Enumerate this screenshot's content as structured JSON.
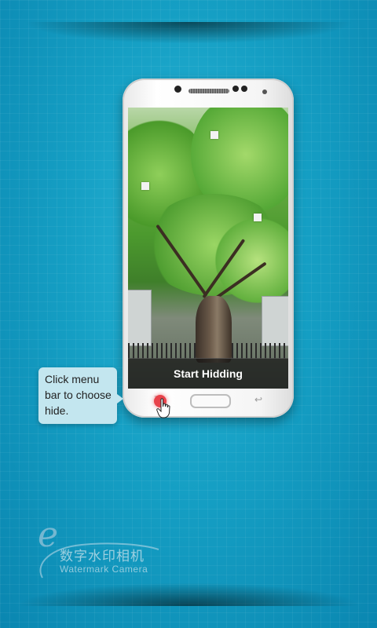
{
  "phone": {
    "screen": {
      "menu_bar_label": "Start Hidding"
    },
    "buttons": {
      "menu_key_icon": "menu-key-icon",
      "home_key_icon": "home-button-icon",
      "back_key_icon": "back-key-icon"
    }
  },
  "tooltip": {
    "lines": [
      "Click menu",
      "bar to choose",
      "hide."
    ]
  },
  "logo": {
    "mark": "e",
    "chinese_name": "数字水印相机",
    "english_name": "Watermark Camera"
  },
  "colors": {
    "background": "#159fc4",
    "tap_indicator": "#e8424a",
    "tooltip_bg": "#c3e6ef"
  }
}
